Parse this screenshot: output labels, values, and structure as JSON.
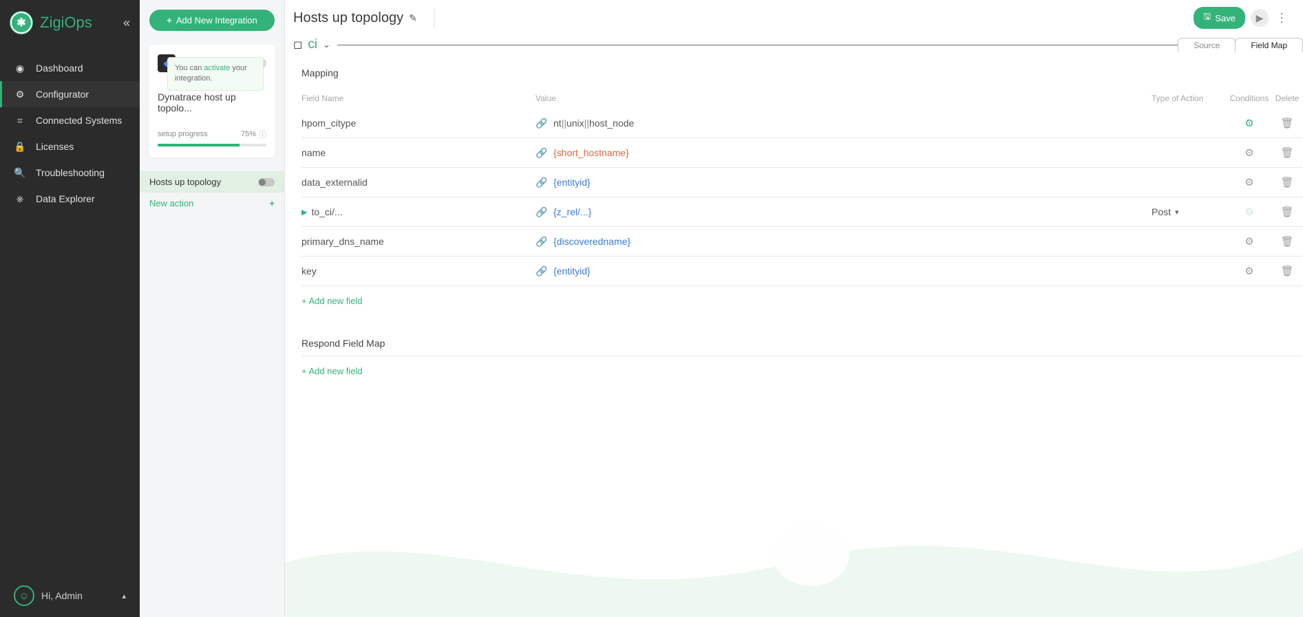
{
  "brand": "ZigiOps",
  "sidebar": {
    "items": [
      {
        "label": "Dashboard"
      },
      {
        "label": "Configurator"
      },
      {
        "label": "Connected Systems"
      },
      {
        "label": "Licenses"
      },
      {
        "label": "Troubleshooting"
      },
      {
        "label": "Data Explorer"
      }
    ]
  },
  "profile": {
    "greeting": "Hi, Admin"
  },
  "panel2": {
    "add_button": "Add New Integration",
    "tooltip_pre": "You can ",
    "tooltip_link": "activate",
    "tooltip_post": " your integration.",
    "card_title": "Dynatrace host up topolo...",
    "progress_label": "setup progress",
    "progress_value": "75%",
    "progress_width": "75%",
    "actions": [
      {
        "label": "Hosts up topology"
      },
      {
        "label": "New action"
      }
    ]
  },
  "page": {
    "title": "Hosts up topology",
    "save_label": "Save",
    "breadcrumb": "ci",
    "tabs": {
      "source": "Source",
      "fieldmap": "Field Map"
    },
    "mapping_title": "Mapping",
    "respond_title": "Respond Field Map",
    "add_field": "+ Add new field",
    "headers": {
      "field": "Field Name",
      "value": "Value",
      "action": "Type of Action",
      "conditions": "Conditions",
      "delete": "Delete"
    },
    "rows": [
      {
        "field": "hpom_citype",
        "value_parts": [
          {
            "t": "nt",
            "c": "plain"
          },
          {
            "t": "||",
            "c": "sep"
          },
          {
            "t": "unix",
            "c": "plain"
          },
          {
            "t": "||",
            "c": "sep"
          },
          {
            "t": "host_node",
            "c": "plain"
          }
        ],
        "action": "",
        "gear": "green"
      },
      {
        "field": "name",
        "value_parts": [
          {
            "t": "{short_hostname}",
            "c": "orange"
          }
        ],
        "action": "",
        "gear": "grey"
      },
      {
        "field": "data_externalid",
        "value_parts": [
          {
            "t": "{entityid}",
            "c": "blue"
          }
        ],
        "action": "",
        "gear": "grey"
      },
      {
        "field": "to_ci/...",
        "expand": true,
        "value_parts": [
          {
            "t": "{z_rel/...}",
            "c": "blue"
          }
        ],
        "action": "Post",
        "gear": "faded"
      },
      {
        "field": "primary_dns_name",
        "value_parts": [
          {
            "t": "{discoveredname}",
            "c": "blue"
          }
        ],
        "action": "",
        "gear": "grey"
      },
      {
        "field": "key",
        "value_parts": [
          {
            "t": "{entityid}",
            "c": "blue"
          }
        ],
        "action": "",
        "gear": "grey"
      }
    ]
  }
}
